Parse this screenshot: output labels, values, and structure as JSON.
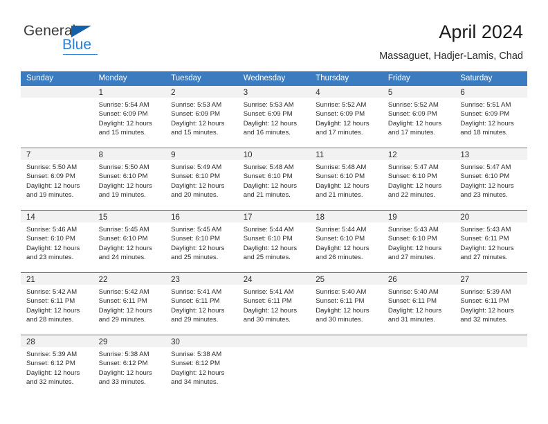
{
  "brand": {
    "name_part1": "General",
    "name_part2": "Blue",
    "triangle_color": "#1461a8",
    "blue_color": "#2a7fd4"
  },
  "header": {
    "title": "April 2024",
    "subtitle": "Massaguet, Hadjer-Lamis, Chad"
  },
  "theme": {
    "header_bar_color": "#3b7cc0",
    "daynum_band_color": "#f2f2f2",
    "text_color": "#2b2b2b"
  },
  "weekdays": [
    "Sunday",
    "Monday",
    "Tuesday",
    "Wednesday",
    "Thursday",
    "Friday",
    "Saturday"
  ],
  "weeks": [
    [
      {
        "day": "",
        "sunrise": "",
        "sunset": "",
        "daylight1": "",
        "daylight2": ""
      },
      {
        "day": "1",
        "sunrise": "Sunrise: 5:54 AM",
        "sunset": "Sunset: 6:09 PM",
        "daylight1": "Daylight: 12 hours",
        "daylight2": "and 15 minutes."
      },
      {
        "day": "2",
        "sunrise": "Sunrise: 5:53 AM",
        "sunset": "Sunset: 6:09 PM",
        "daylight1": "Daylight: 12 hours",
        "daylight2": "and 15 minutes."
      },
      {
        "day": "3",
        "sunrise": "Sunrise: 5:53 AM",
        "sunset": "Sunset: 6:09 PM",
        "daylight1": "Daylight: 12 hours",
        "daylight2": "and 16 minutes."
      },
      {
        "day": "4",
        "sunrise": "Sunrise: 5:52 AM",
        "sunset": "Sunset: 6:09 PM",
        "daylight1": "Daylight: 12 hours",
        "daylight2": "and 17 minutes."
      },
      {
        "day": "5",
        "sunrise": "Sunrise: 5:52 AM",
        "sunset": "Sunset: 6:09 PM",
        "daylight1": "Daylight: 12 hours",
        "daylight2": "and 17 minutes."
      },
      {
        "day": "6",
        "sunrise": "Sunrise: 5:51 AM",
        "sunset": "Sunset: 6:09 PM",
        "daylight1": "Daylight: 12 hours",
        "daylight2": "and 18 minutes."
      }
    ],
    [
      {
        "day": "7",
        "sunrise": "Sunrise: 5:50 AM",
        "sunset": "Sunset: 6:09 PM",
        "daylight1": "Daylight: 12 hours",
        "daylight2": "and 19 minutes."
      },
      {
        "day": "8",
        "sunrise": "Sunrise: 5:50 AM",
        "sunset": "Sunset: 6:10 PM",
        "daylight1": "Daylight: 12 hours",
        "daylight2": "and 19 minutes."
      },
      {
        "day": "9",
        "sunrise": "Sunrise: 5:49 AM",
        "sunset": "Sunset: 6:10 PM",
        "daylight1": "Daylight: 12 hours",
        "daylight2": "and 20 minutes."
      },
      {
        "day": "10",
        "sunrise": "Sunrise: 5:48 AM",
        "sunset": "Sunset: 6:10 PM",
        "daylight1": "Daylight: 12 hours",
        "daylight2": "and 21 minutes."
      },
      {
        "day": "11",
        "sunrise": "Sunrise: 5:48 AM",
        "sunset": "Sunset: 6:10 PM",
        "daylight1": "Daylight: 12 hours",
        "daylight2": "and 21 minutes."
      },
      {
        "day": "12",
        "sunrise": "Sunrise: 5:47 AM",
        "sunset": "Sunset: 6:10 PM",
        "daylight1": "Daylight: 12 hours",
        "daylight2": "and 22 minutes."
      },
      {
        "day": "13",
        "sunrise": "Sunrise: 5:47 AM",
        "sunset": "Sunset: 6:10 PM",
        "daylight1": "Daylight: 12 hours",
        "daylight2": "and 23 minutes."
      }
    ],
    [
      {
        "day": "14",
        "sunrise": "Sunrise: 5:46 AM",
        "sunset": "Sunset: 6:10 PM",
        "daylight1": "Daylight: 12 hours",
        "daylight2": "and 23 minutes."
      },
      {
        "day": "15",
        "sunrise": "Sunrise: 5:45 AM",
        "sunset": "Sunset: 6:10 PM",
        "daylight1": "Daylight: 12 hours",
        "daylight2": "and 24 minutes."
      },
      {
        "day": "16",
        "sunrise": "Sunrise: 5:45 AM",
        "sunset": "Sunset: 6:10 PM",
        "daylight1": "Daylight: 12 hours",
        "daylight2": "and 25 minutes."
      },
      {
        "day": "17",
        "sunrise": "Sunrise: 5:44 AM",
        "sunset": "Sunset: 6:10 PM",
        "daylight1": "Daylight: 12 hours",
        "daylight2": "and 25 minutes."
      },
      {
        "day": "18",
        "sunrise": "Sunrise: 5:44 AM",
        "sunset": "Sunset: 6:10 PM",
        "daylight1": "Daylight: 12 hours",
        "daylight2": "and 26 minutes."
      },
      {
        "day": "19",
        "sunrise": "Sunrise: 5:43 AM",
        "sunset": "Sunset: 6:10 PM",
        "daylight1": "Daylight: 12 hours",
        "daylight2": "and 27 minutes."
      },
      {
        "day": "20",
        "sunrise": "Sunrise: 5:43 AM",
        "sunset": "Sunset: 6:11 PM",
        "daylight1": "Daylight: 12 hours",
        "daylight2": "and 27 minutes."
      }
    ],
    [
      {
        "day": "21",
        "sunrise": "Sunrise: 5:42 AM",
        "sunset": "Sunset: 6:11 PM",
        "daylight1": "Daylight: 12 hours",
        "daylight2": "and 28 minutes."
      },
      {
        "day": "22",
        "sunrise": "Sunrise: 5:42 AM",
        "sunset": "Sunset: 6:11 PM",
        "daylight1": "Daylight: 12 hours",
        "daylight2": "and 29 minutes."
      },
      {
        "day": "23",
        "sunrise": "Sunrise: 5:41 AM",
        "sunset": "Sunset: 6:11 PM",
        "daylight1": "Daylight: 12 hours",
        "daylight2": "and 29 minutes."
      },
      {
        "day": "24",
        "sunrise": "Sunrise: 5:41 AM",
        "sunset": "Sunset: 6:11 PM",
        "daylight1": "Daylight: 12 hours",
        "daylight2": "and 30 minutes."
      },
      {
        "day": "25",
        "sunrise": "Sunrise: 5:40 AM",
        "sunset": "Sunset: 6:11 PM",
        "daylight1": "Daylight: 12 hours",
        "daylight2": "and 30 minutes."
      },
      {
        "day": "26",
        "sunrise": "Sunrise: 5:40 AM",
        "sunset": "Sunset: 6:11 PM",
        "daylight1": "Daylight: 12 hours",
        "daylight2": "and 31 minutes."
      },
      {
        "day": "27",
        "sunrise": "Sunrise: 5:39 AM",
        "sunset": "Sunset: 6:11 PM",
        "daylight1": "Daylight: 12 hours",
        "daylight2": "and 32 minutes."
      }
    ],
    [
      {
        "day": "28",
        "sunrise": "Sunrise: 5:39 AM",
        "sunset": "Sunset: 6:12 PM",
        "daylight1": "Daylight: 12 hours",
        "daylight2": "and 32 minutes."
      },
      {
        "day": "29",
        "sunrise": "Sunrise: 5:38 AM",
        "sunset": "Sunset: 6:12 PM",
        "daylight1": "Daylight: 12 hours",
        "daylight2": "and 33 minutes."
      },
      {
        "day": "30",
        "sunrise": "Sunrise: 5:38 AM",
        "sunset": "Sunset: 6:12 PM",
        "daylight1": "Daylight: 12 hours",
        "daylight2": "and 34 minutes."
      },
      {
        "day": "",
        "sunrise": "",
        "sunset": "",
        "daylight1": "",
        "daylight2": ""
      },
      {
        "day": "",
        "sunrise": "",
        "sunset": "",
        "daylight1": "",
        "daylight2": ""
      },
      {
        "day": "",
        "sunrise": "",
        "sunset": "",
        "daylight1": "",
        "daylight2": ""
      },
      {
        "day": "",
        "sunrise": "",
        "sunset": "",
        "daylight1": "",
        "daylight2": ""
      }
    ]
  ]
}
